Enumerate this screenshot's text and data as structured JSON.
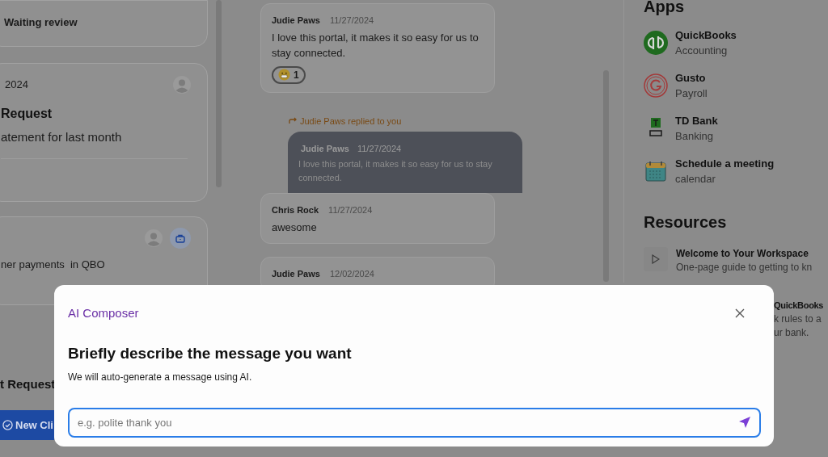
{
  "requests_column": {
    "cards": [
      {
        "status": "Waiting review"
      },
      {
        "date": "2024",
        "title": "Request",
        "description": "atement for last month",
        "avatar": true
      },
      {
        "description": "ner payments  in QBO",
        "avatar": true,
        "briefcase": true
      }
    ],
    "cut_title": "t Request",
    "new_button": "New Cli"
  },
  "conversation": {
    "messages": [
      {
        "kind": "message",
        "author": "Judie Paws",
        "date": "11/27/2024",
        "text": "I love this portal, it makes it so easy for us to stay connected.",
        "reaction_count": "1"
      },
      {
        "kind": "reply",
        "label": "Judie Paws replied to you",
        "author": "Judie Paws",
        "date": "11/27/2024",
        "text": "I love this portal, it makes it so easy for us to stay connected."
      },
      {
        "kind": "message",
        "author": "Chris Rock",
        "date": "11/27/2024",
        "text": "awesome"
      },
      {
        "kind": "message",
        "author": "Judie Paws",
        "date": "12/02/2024"
      }
    ]
  },
  "apps": {
    "title": "Apps",
    "items": [
      {
        "kind": "quickbooks",
        "name": "QuickBooks",
        "category": "Accounting"
      },
      {
        "kind": "gusto",
        "name": "Gusto",
        "category": "Payroll"
      },
      {
        "kind": "bank",
        "name": "TD Bank",
        "category": "Banking"
      },
      {
        "kind": "calendar",
        "name": "Schedule a meeting",
        "category": "calendar"
      }
    ]
  },
  "resources": {
    "title": "Resources",
    "items": [
      {
        "title": "Welcome to Your Workspace",
        "description": "One-page guide to getting to kn"
      },
      {
        "title": "QuickBooks",
        "description_lines": [
          "k rules to a",
          "ur bank."
        ]
      }
    ]
  },
  "dialog": {
    "label": "AI Composer",
    "heading": "Briefly describe the message you want",
    "subtitle": "We will auto-generate a message using AI.",
    "input": {
      "placeholder": "e.g. polite thank you"
    }
  }
}
